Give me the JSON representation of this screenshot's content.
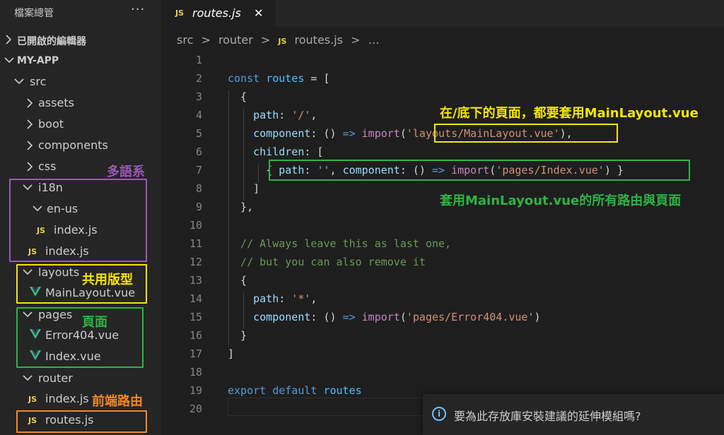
{
  "explorer": {
    "title": "檔案總管",
    "more": "···",
    "open_editors": "已開啟的編輯器",
    "project": "MY-APP",
    "tree": {
      "src": "src",
      "assets": "assets",
      "boot": "boot",
      "components": "components",
      "css": "css",
      "i18n": "i18n",
      "en_us": "en-us",
      "en_us_index": "index.js",
      "i18n_index": "index.js",
      "layouts": "layouts",
      "main_layout": "MainLayout.vue",
      "pages": "pages",
      "error404": "Error404.vue",
      "index_vue": "Index.vue",
      "router": "router",
      "router_index": "index.js",
      "routes": "routes.js"
    },
    "annotations": {
      "i18n": "多語系",
      "layouts": "共用版型",
      "pages": "頁面",
      "router": "前端路由"
    }
  },
  "editor": {
    "tab": {
      "icon": "JS",
      "name": "routes.js",
      "close": "✕"
    },
    "breadcrumb": {
      "p1": "src",
      "p2": "router",
      "icon": "JS",
      "file": "routes.js",
      "more": "…",
      "sep": ">"
    },
    "line_numbers": [
      "1",
      "2",
      "3",
      "4",
      "5",
      "6",
      "7",
      "8",
      "9",
      "10",
      "11",
      "12",
      "13",
      "14",
      "15",
      "16",
      "17",
      "18",
      "19",
      "20"
    ],
    "annotations": {
      "main_layout": "在/底下的頁面，都要套用MainLayout.vue",
      "children": "套用MainLayout.vue的所有路由與頁面"
    }
  },
  "notification": {
    "icon": "i",
    "message": "要為此存放庫安裝建議的延伸模組嗎?"
  },
  "colors": {
    "purple": "#9b59b6",
    "yellow": "#f5e600",
    "green": "#2fb344",
    "orange": "#f0882a"
  }
}
